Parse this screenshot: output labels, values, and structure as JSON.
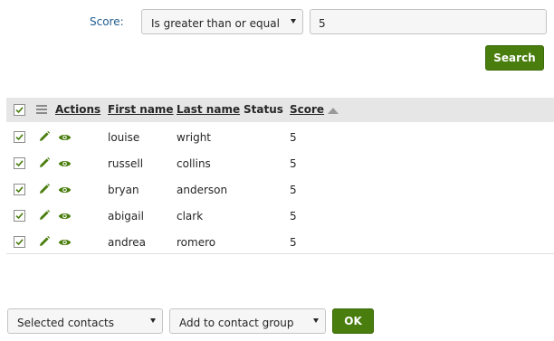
{
  "filter": {
    "score_label": "Score:",
    "operator_value": "Is greater than or equal",
    "score_value": "5",
    "search_label": "Search"
  },
  "table": {
    "headers": {
      "actions": "Actions",
      "first_name": "First name",
      "last_name": "Last name",
      "status": "Status",
      "score": "Score"
    },
    "sort": {
      "column": "score",
      "direction": "ascending"
    },
    "rows": [
      {
        "first_name": "louise",
        "last_name": "wright",
        "status": "",
        "score": "5",
        "checked": true
      },
      {
        "first_name": "russell",
        "last_name": "collins",
        "status": "",
        "score": "5",
        "checked": true
      },
      {
        "first_name": "bryan",
        "last_name": "anderson",
        "status": "",
        "score": "5",
        "checked": true
      },
      {
        "first_name": "abigail",
        "last_name": "clark",
        "status": "",
        "score": "5",
        "checked": true
      },
      {
        "first_name": "andrea",
        "last_name": "romero",
        "status": "",
        "score": "5",
        "checked": true
      }
    ]
  },
  "bulk": {
    "selection_value": "Selected contacts",
    "action_value": "Add to contact group",
    "ok_label": "OK"
  },
  "icons": {
    "edit": "pencil-icon",
    "view": "eye-icon",
    "select_all": "checkbox-icon",
    "columns": "menu-icon"
  },
  "colors": {
    "primary_button": "#497d0d",
    "icon_green": "#497d0d",
    "label_blue": "#1f5b8f",
    "header_bg": "#e6e6e6"
  }
}
